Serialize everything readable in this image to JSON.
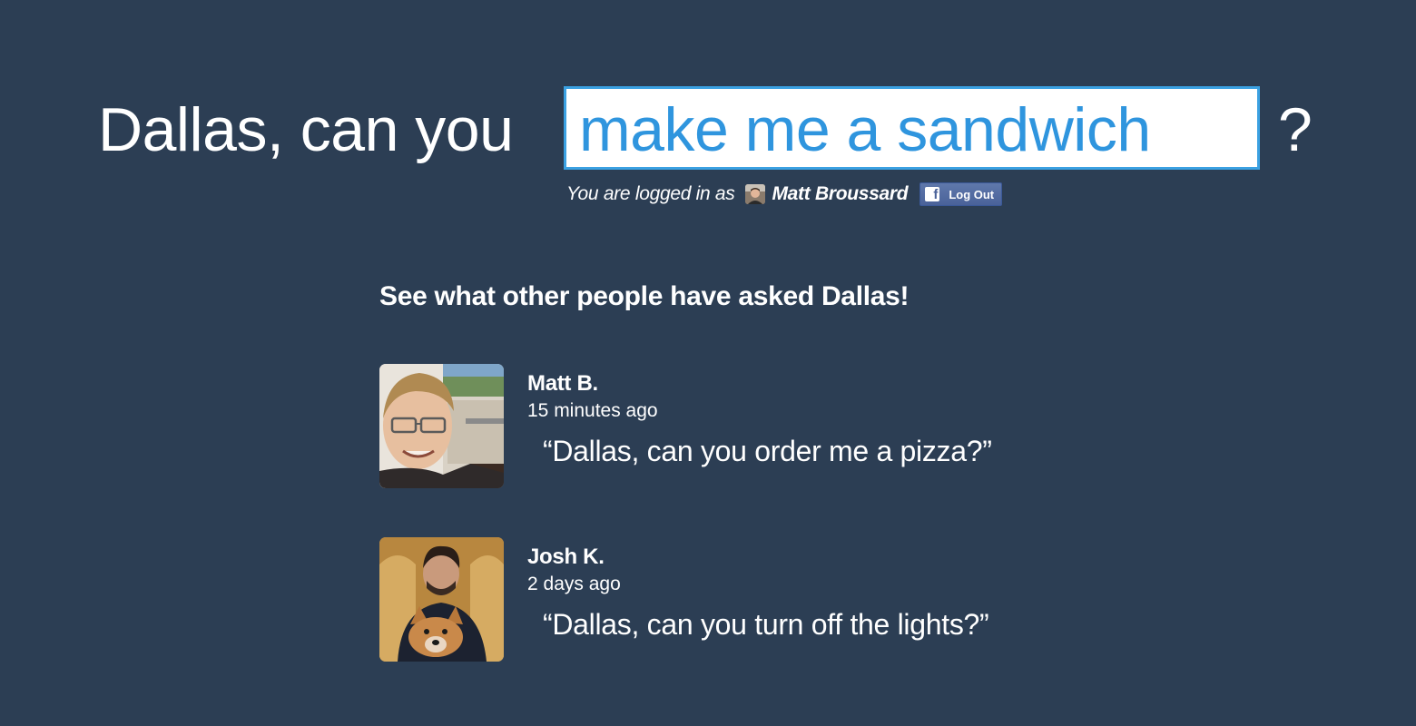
{
  "hero": {
    "prefix": "Dallas, can you",
    "input_value": "make me a sandwich",
    "suffix": "?"
  },
  "login": {
    "prefix": "You are logged in as",
    "user_name": "Matt Broussard",
    "logout_label": "Log Out",
    "fb_glyph": "f"
  },
  "feed": {
    "heading": "See what other people have asked Dallas!",
    "items": [
      {
        "author": "Matt B.",
        "time": "15 minutes ago",
        "quote": "“Dallas, can you order me a pizza?”"
      },
      {
        "author": "Josh K.",
        "time": "2 days ago",
        "quote": "“Dallas, can you turn off the lights?”"
      }
    ]
  },
  "colors": {
    "background": "#2c3e54",
    "input_border": "#3ba1e2",
    "input_text": "#2f95de",
    "facebook_button": "#4a6299"
  },
  "icons": {
    "facebook": "facebook-icon"
  }
}
